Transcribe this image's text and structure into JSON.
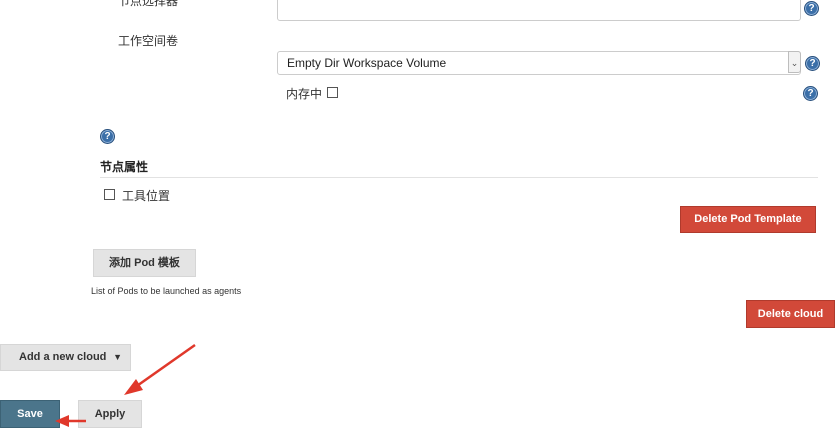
{
  "form": {
    "node_selector_label": "节点选择器",
    "node_selector_value": "",
    "workspace_volume_label": "工作空间卷",
    "workspace_volume_selected": "Empty Dir Workspace Volume",
    "in_memory_label": "内存中",
    "in_memory_checked": false
  },
  "node_properties": {
    "title": "节点属性",
    "tool_location_label": "工具位置",
    "tool_location_checked": false
  },
  "buttons": {
    "delete_pod_template": "Delete Pod Template",
    "add_pod_template": "添加 Pod 模板",
    "delete_cloud": "Delete cloud",
    "add_new_cloud": "Add a new cloud",
    "save": "Save",
    "apply": "Apply"
  },
  "hints": {
    "pods_description": "List of Pods to be launched as agents"
  },
  "icons": {
    "help": "help-icon",
    "dropdown": "chevron-down-icon",
    "caret": "caret-down-icon"
  },
  "colors": {
    "delete_red": "#d24939",
    "save_blue": "#4b758b",
    "annotation_red": "#e0382b",
    "help_blue": "#3b6fa8"
  }
}
